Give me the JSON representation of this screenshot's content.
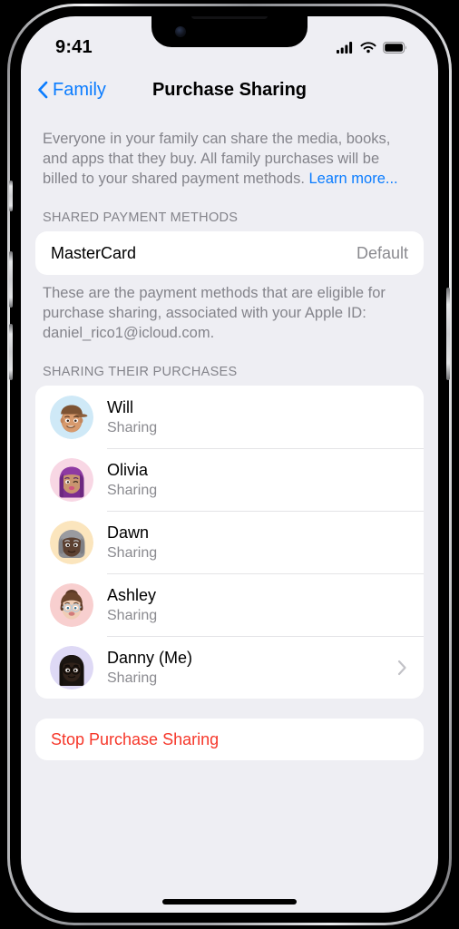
{
  "status_bar": {
    "time": "9:41",
    "cellular_icon": "signal-bars-icon",
    "wifi_icon": "wifi-icon",
    "battery_icon": "battery-full-icon"
  },
  "nav": {
    "back_label": "Family",
    "back_icon": "chevron-left-icon",
    "title": "Purchase Sharing"
  },
  "intro": {
    "text": "Everyone in your family can share the media, books, and apps that they buy. All family purchases will be billed to your shared payment methods. ",
    "link_label": "Learn more..."
  },
  "payment_section": {
    "header": "SHARED PAYMENT METHODS",
    "rows": [
      {
        "name": "MasterCard",
        "value": "Default"
      }
    ],
    "footnote": "These are the payment methods that are eligible for purchase sharing, associated with your Apple ID: daniel_rico1@icloud.com."
  },
  "members_section": {
    "header": "SHARING THEIR PURCHASES",
    "members": [
      {
        "name": "Will",
        "status": "Sharing",
        "avatar": "memoji-will-avatar",
        "has_chevron": false
      },
      {
        "name": "Olivia",
        "status": "Sharing",
        "avatar": "memoji-olivia-avatar",
        "has_chevron": false
      },
      {
        "name": "Dawn",
        "status": "Sharing",
        "avatar": "memoji-dawn-avatar",
        "has_chevron": false
      },
      {
        "name": "Ashley",
        "status": "Sharing",
        "avatar": "memoji-ashley-avatar",
        "has_chevron": false
      },
      {
        "name": "Danny (Me)",
        "status": "Sharing",
        "avatar": "memoji-danny-avatar",
        "has_chevron": true
      }
    ]
  },
  "danger_action": {
    "label": "Stop Purchase Sharing"
  },
  "colors": {
    "accent_blue": "#0a7cff",
    "destructive_red": "#f6372a",
    "page_background": "#eeeef3",
    "card_background": "#ffffff",
    "secondary_text": "#84848b"
  }
}
